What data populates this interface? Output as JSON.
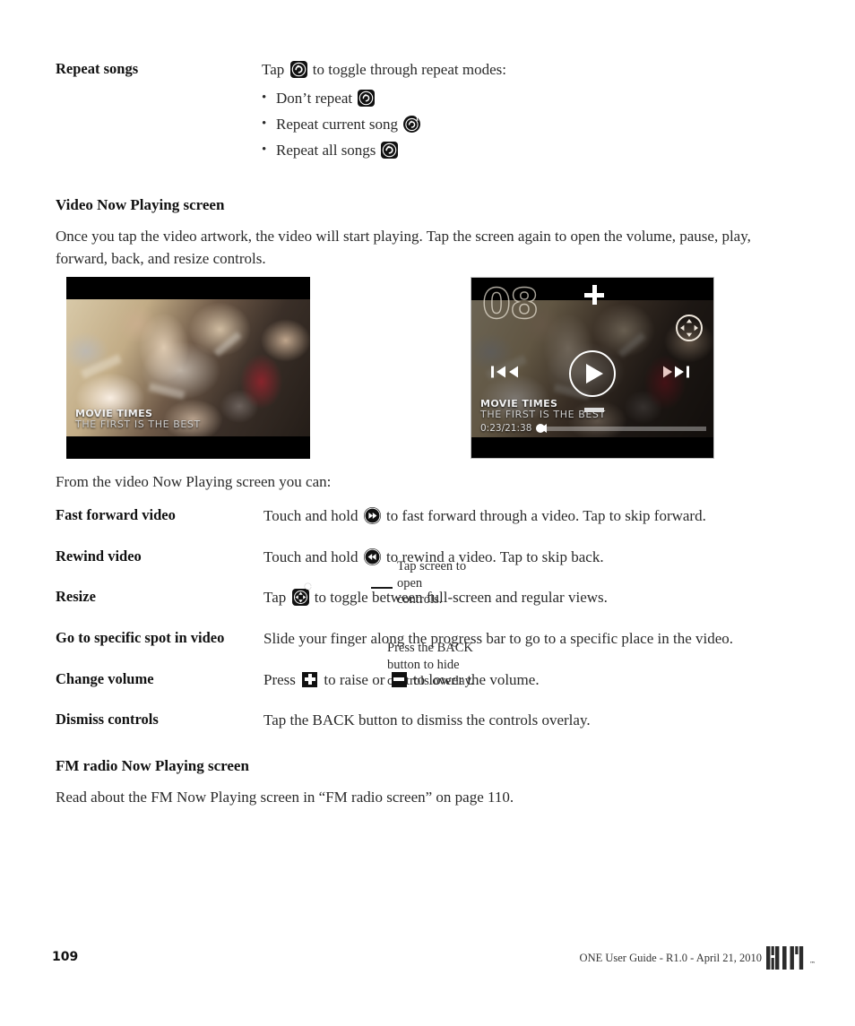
{
  "repeat": {
    "term": "Repeat songs",
    "lead": "Tap",
    "lead_after": "to toggle through repeat modes:",
    "icon": "repeat-icon",
    "bullets": [
      {
        "label": "Don’t repeat",
        "icon": "repeat-off-icon"
      },
      {
        "label": "Repeat current song",
        "icon": "repeat-one-icon"
      },
      {
        "label": "Repeat all songs",
        "icon": "repeat-all-icon"
      }
    ]
  },
  "video_section": {
    "heading": "Video Now Playing screen",
    "intro": "Once you tap the video artwork, the video will start playing. Tap the screen again to open the volume, pause, play, forward, back, and resize controls.",
    "from_line": "From the video Now Playing screen you can:"
  },
  "screenshots": {
    "left": {
      "caption_title": "MOVIE TIMES",
      "caption_subtitle": "THE FIRST IS THE BEST"
    },
    "right": {
      "caption_title": "MOVIE TIMES",
      "caption_subtitle": "THE FIRST IS THE BEST",
      "volume_level": "08",
      "timestamp": "0:23/21:38",
      "icons": {
        "volume_up": "plus-icon",
        "volume_down": "minus-icon",
        "resize": "resize-icon",
        "play": "play-icon",
        "rewind": "rewind-icon",
        "fast_forward": "fast-forward-icon"
      }
    }
  },
  "callouts": {
    "one": "Tap screen to open controls.",
    "two": "Press the BACK button to hide controls overlay."
  },
  "definitions": [
    {
      "term": "Fast forward video",
      "before": "Touch and hold",
      "icon": "fast-forward-icon",
      "after": "to fast forward through a video. Tap to skip forward."
    },
    {
      "term": "Rewind video",
      "before": "Touch and hold",
      "icon": "rewind-icon",
      "after": "to rewind a video. Tap to skip back."
    },
    {
      "term": "Resize",
      "before": "Tap",
      "icon": "resize-icon",
      "after": "to toggle between full-screen and regular views."
    },
    {
      "term": "Go to specific spot in video",
      "before": "",
      "icon": "",
      "after": "Slide your finger along the progress bar to go to a specific place in the video."
    },
    {
      "term": "Change volume",
      "before": "Press",
      "icon": "plus-icon",
      "middle": "to raise or",
      "icon2": "minus-icon",
      "after": "to lower the volume."
    },
    {
      "term": "Dismiss controls",
      "before": "",
      "icon": "",
      "after": "Tap the BACK button to dismiss the controls overlay."
    }
  ],
  "fm_section": {
    "heading": "FM radio Now Playing screen",
    "body": "Read about the FM Now Playing screen in “FM radio screen” on page 110."
  },
  "footer": {
    "page_number": "109",
    "meta": "ONE User Guide - R1.0 - April 21, 2010",
    "logo": "KIN",
    "trademark": "™"
  }
}
